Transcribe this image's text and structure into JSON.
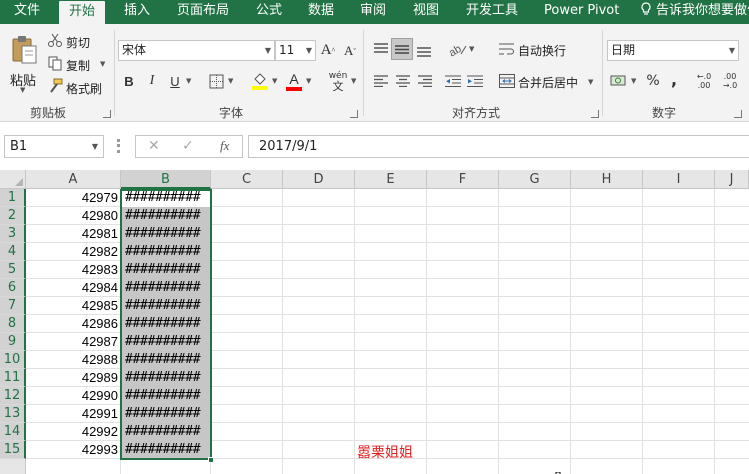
{
  "tabs": [
    "文件",
    "开始",
    "插入",
    "页面布局",
    "公式",
    "数据",
    "审阅",
    "视图",
    "开发工具",
    "Power Pivot"
  ],
  "active_tab": "开始",
  "tell_me": "告诉我你想要做什",
  "ribbon": {
    "clipboard": {
      "paste": "粘贴",
      "cut": "剪切",
      "copy": "复制",
      "format_painter": "格式刷",
      "group_label": "剪贴板"
    },
    "font": {
      "font_name": "宋体",
      "font_size": "11",
      "grow": "A",
      "shrink": "A",
      "bold": "B",
      "italic": "I",
      "underline": "U",
      "font_color_letter": "A",
      "phonetic": "wén",
      "group_label": "字体"
    },
    "alignment": {
      "wrap_text": "自动换行",
      "merge_center": "合并后居中",
      "group_label": "对齐方式"
    },
    "number": {
      "format": "日期",
      "percent": "%",
      "comma": ",",
      "inc_decimal": "←.0 .00",
      "dec_decimal": ".00 →.0",
      "group_label": "数字"
    }
  },
  "formula_bar": {
    "name_box": "B1",
    "cancel": "✕",
    "enter": "✓",
    "fx": "fx",
    "formula": "2017/9/1"
  },
  "columns": [
    "A",
    "B",
    "C",
    "D",
    "E",
    "F",
    "G",
    "H",
    "I",
    "J"
  ],
  "selected_column": "B",
  "rows": [
    {
      "n": "1",
      "a": "42979",
      "b": "##########"
    },
    {
      "n": "2",
      "a": "42980",
      "b": "##########"
    },
    {
      "n": "3",
      "a": "42981",
      "b": "##########"
    },
    {
      "n": "4",
      "a": "42982",
      "b": "##########"
    },
    {
      "n": "5",
      "a": "42983",
      "b": "##########"
    },
    {
      "n": "6",
      "a": "42984",
      "b": "##########"
    },
    {
      "n": "7",
      "a": "42985",
      "b": "##########"
    },
    {
      "n": "8",
      "a": "42986",
      "b": "##########"
    },
    {
      "n": "9",
      "a": "42987",
      "b": "##########"
    },
    {
      "n": "10",
      "a": "42988",
      "b": "##########"
    },
    {
      "n": "11",
      "a": "42989",
      "b": "##########"
    },
    {
      "n": "12",
      "a": "42990",
      "b": "##########"
    },
    {
      "n": "13",
      "a": "42991",
      "b": "##########"
    },
    {
      "n": "14",
      "a": "42992",
      "b": "##########"
    },
    {
      "n": "15",
      "a": "42993",
      "b": "##########"
    }
  ],
  "watermark": "嚣栗姐姐",
  "colors": {
    "excel_green": "#217346",
    "ribbon_bg": "#f3f3f3",
    "selection_fill": "#c6c6c6",
    "highlight_yellow": "#ffff00",
    "font_color_red": "#ff0000",
    "watermark_red": "#e02020"
  }
}
